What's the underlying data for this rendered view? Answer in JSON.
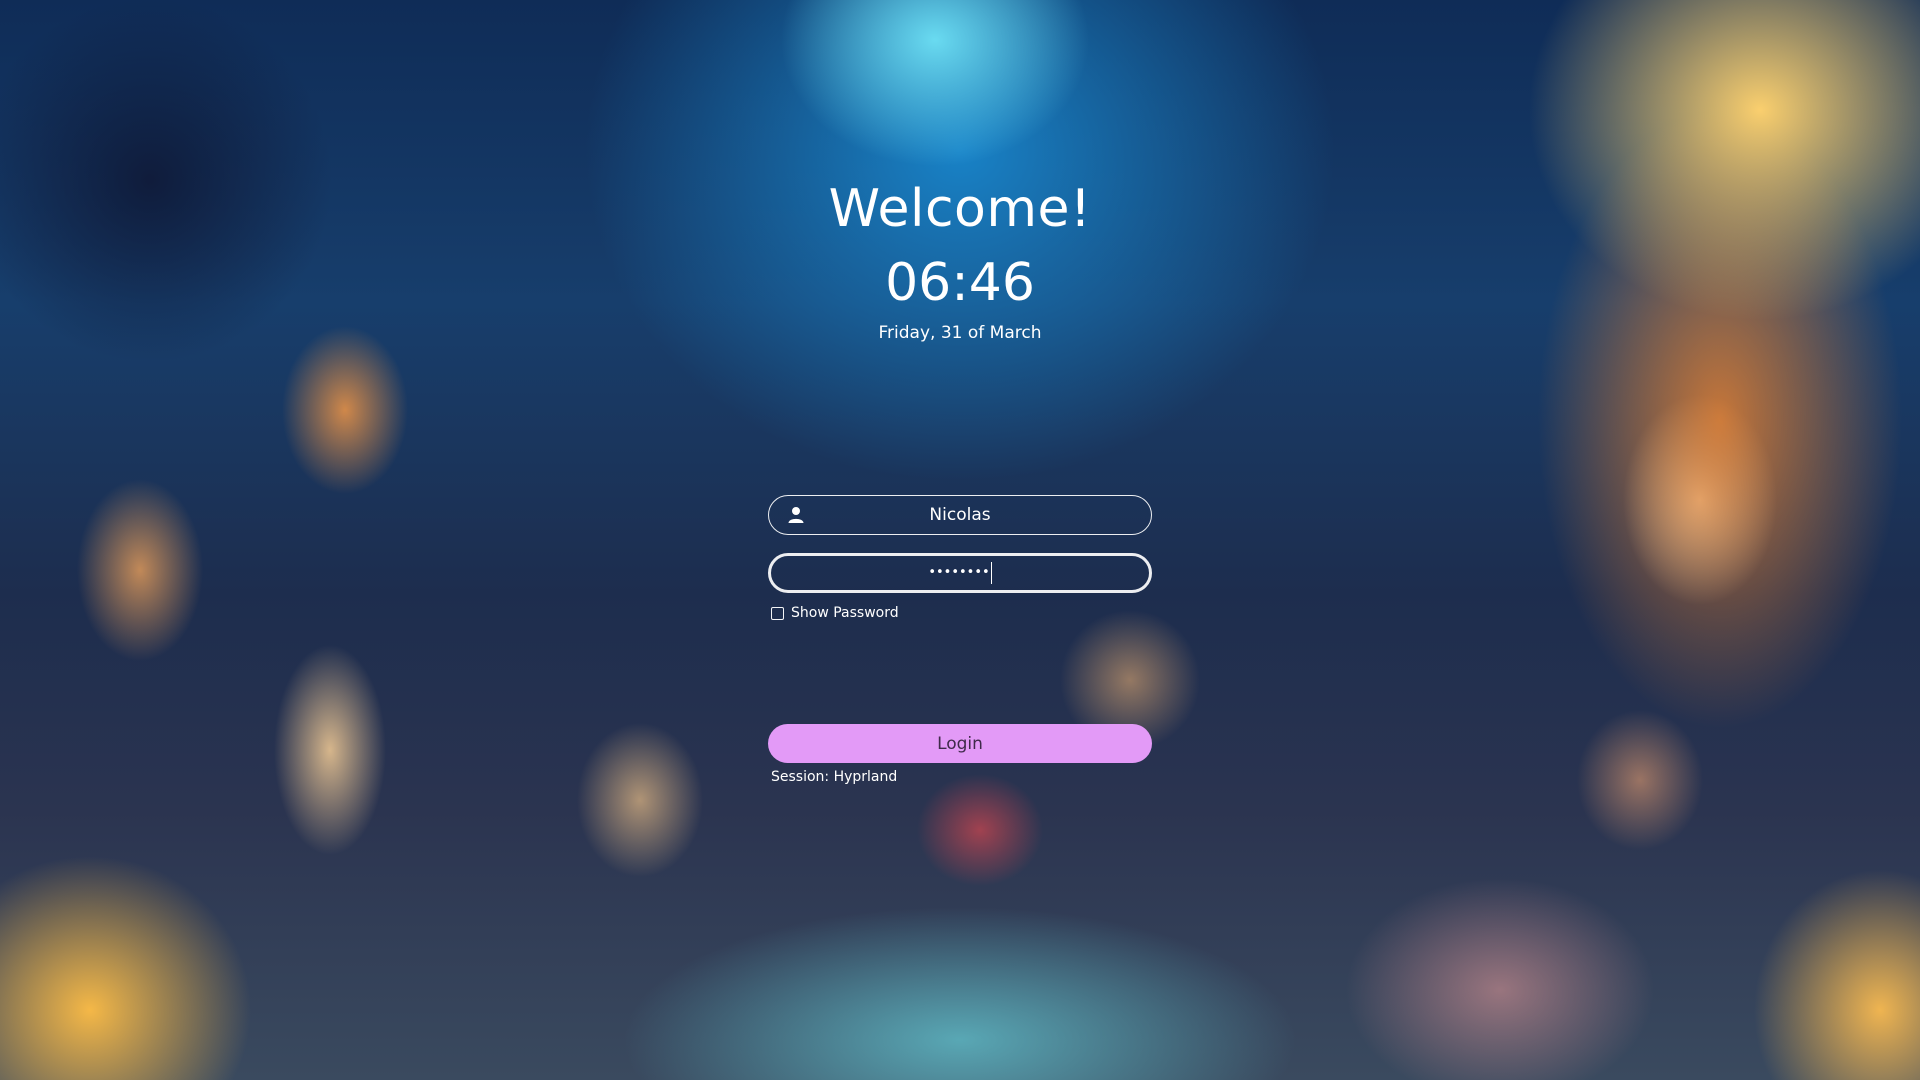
{
  "greeting": {
    "title": "Welcome!",
    "time": "06:46",
    "date": "Friday, 31 of March"
  },
  "login": {
    "username": "Nicolas",
    "user_icon": "user-icon",
    "password_mask": "••••••••",
    "show_password_label": "Show Password",
    "show_password_checked": false,
    "login_button_label": "Login",
    "session_label": "Session: Hyprland"
  },
  "colors": {
    "login_button": "#e39af7",
    "login_button_text": "#3f2a4a",
    "text": "#ffffff"
  }
}
